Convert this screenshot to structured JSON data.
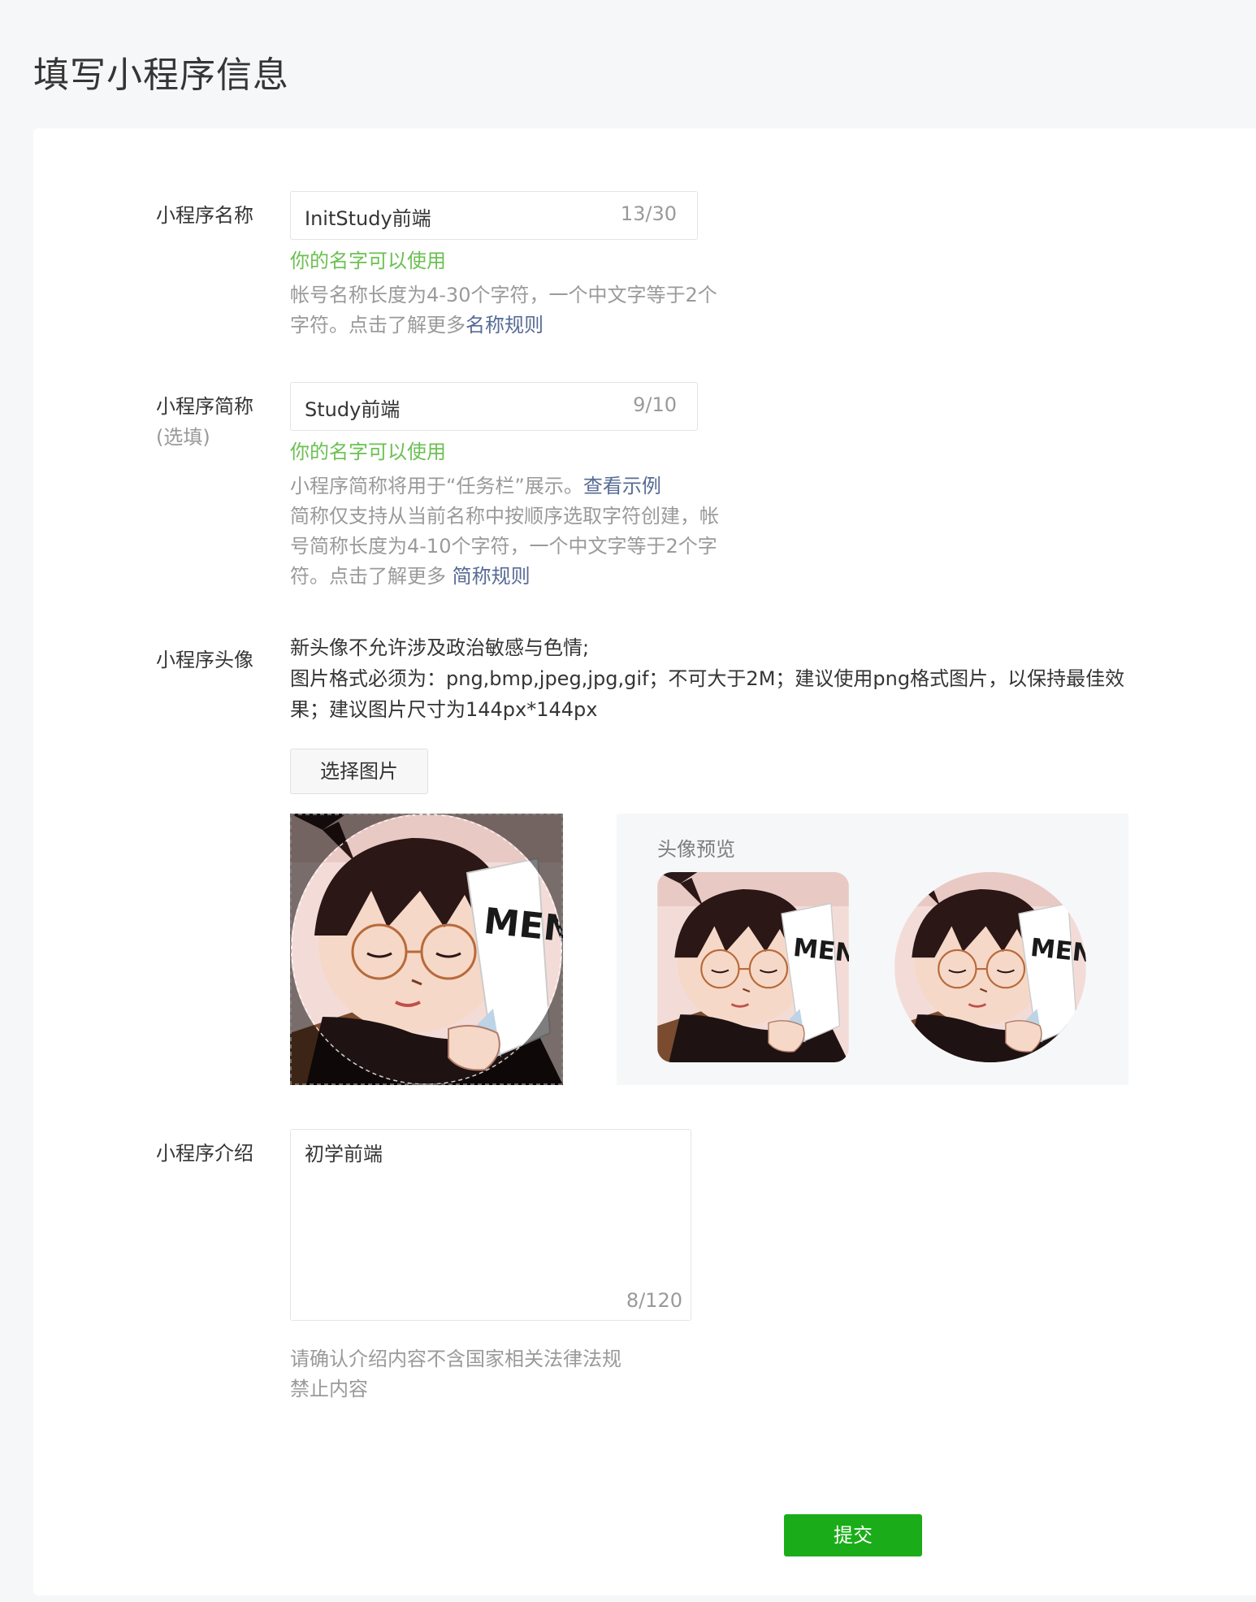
{
  "page": {
    "title": "填写小程序信息"
  },
  "name_field": {
    "label": "小程序名称",
    "value": "InitStudy前端",
    "counter": "13/30",
    "status": "你的名字可以使用",
    "hint_text": "帐号名称长度为4-30个字符，一个中文字等于2个字符。点击了解更多",
    "hint_link": "名称规则"
  },
  "short_name_field": {
    "label": "小程序简称",
    "label_sub": "(选填)",
    "value": "Study前端",
    "counter": "9/10",
    "status": "你的名字可以使用",
    "hint_line1": "小程序简称将用于“任务栏”展示。",
    "hint_link1": "查看示例",
    "hint_line2": "简称仅支持从当前名称中按顺序选取字符创建，帐号简称长度为4-10个字符，一个中文字等于2个字符。点击了解更多 ",
    "hint_link2": "简称规则"
  },
  "avatar_field": {
    "label": "小程序头像",
    "desc_line1": "新头像不允许涉及政治敏感与色情;",
    "desc_line2": "图片格式必须为：png,bmp,jpeg,jpg,gif；不可大于2M；建议使用png格式图片，以保持最佳效果；建议图片尺寸为144px*144px",
    "select_button": "选择图片",
    "preview_title": "头像预览",
    "menu_text": "MENU"
  },
  "intro_field": {
    "label": "小程序介绍",
    "value": "初学前端",
    "counter": "8/120",
    "hint_line1": "请确认介绍内容不含国家相关法律法规",
    "hint_line2": "禁止内容"
  },
  "submit_button": "提交"
}
